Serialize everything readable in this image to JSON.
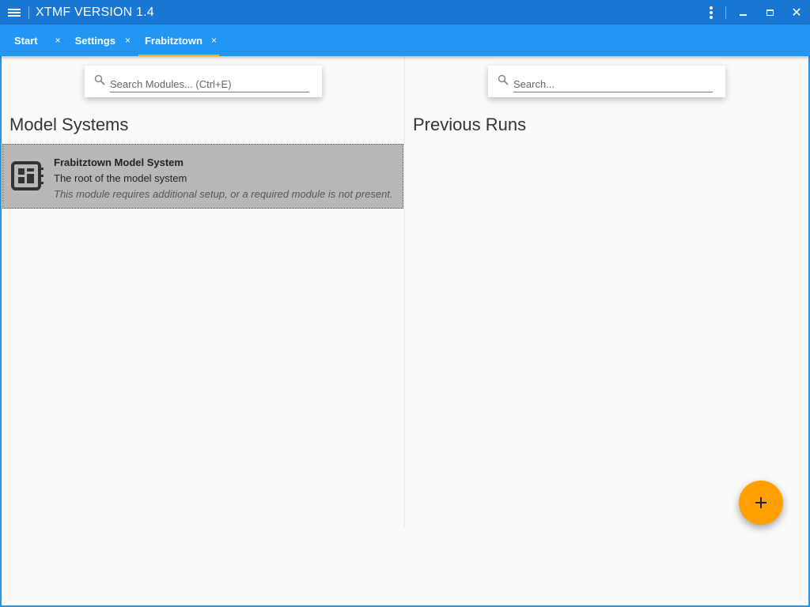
{
  "window": {
    "title": "XTMF VERSION 1.4",
    "controls": {
      "menu_icon": "hamburger-icon",
      "more_icon": "more-vert-icon",
      "minimize_icon": "minimize-icon",
      "maximize_icon": "maximize-icon",
      "close_symbol": "✕"
    }
  },
  "tabs": [
    {
      "label": "Start",
      "close": "",
      "active": false
    },
    {
      "label": "Settings",
      "close": "×",
      "active": false
    },
    {
      "label": "Frabitztown",
      "close": "×",
      "active": true
    }
  ],
  "start_tab_close": "×",
  "left_panel": {
    "search_placeholder": "Search Modules... (Ctrl+E)",
    "section_title": "Model Systems",
    "items": [
      {
        "name": "Frabitztown Model System",
        "description": "The root of the model system",
        "warning": "This module requires additional setup, or a required module is not present.",
        "icon": "model-system-icon"
      }
    ]
  },
  "right_panel": {
    "search_placeholder": "Search...",
    "section_title": "Previous Runs"
  },
  "fab": {
    "symbol": "+",
    "icon": "add-icon"
  },
  "colors": {
    "titlebar": "#1976d2",
    "tabbar": "#2196f3",
    "tab_indicator": "#ffb300",
    "fab": "#ffa000",
    "selected_item": "#b8b8b8"
  }
}
